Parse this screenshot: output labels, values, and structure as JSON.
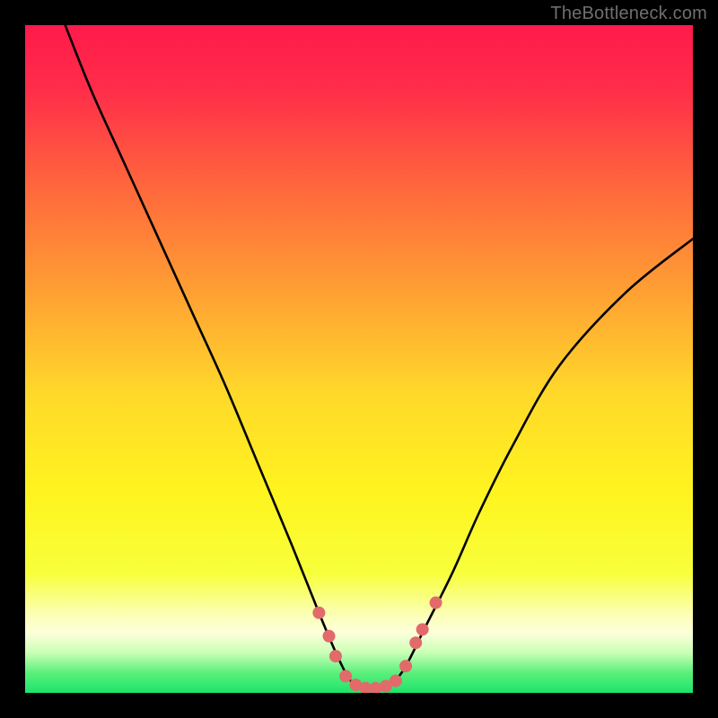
{
  "watermark": "TheBottleneck.com",
  "chart_data": {
    "type": "line",
    "title": "",
    "xlabel": "",
    "ylabel": "",
    "xlim": [
      0,
      100
    ],
    "ylim": [
      0,
      100
    ],
    "background_gradient": {
      "stops": [
        {
          "offset": 0.0,
          "color": "#ff1a4b"
        },
        {
          "offset": 0.1,
          "color": "#ff2e49"
        },
        {
          "offset": 0.25,
          "color": "#ff6a3c"
        },
        {
          "offset": 0.4,
          "color": "#ffa033"
        },
        {
          "offset": 0.55,
          "color": "#ffd82a"
        },
        {
          "offset": 0.7,
          "color": "#fff41f"
        },
        {
          "offset": 0.82,
          "color": "#f7ff3a"
        },
        {
          "offset": 0.88,
          "color": "#fbffb0"
        },
        {
          "offset": 0.91,
          "color": "#fdffdc"
        },
        {
          "offset": 0.94,
          "color": "#c9ffb5"
        },
        {
          "offset": 0.97,
          "color": "#5af07c"
        },
        {
          "offset": 1.0,
          "color": "#1de46a"
        }
      ]
    },
    "series": [
      {
        "name": "bottleneck-curve",
        "stroke": "#000000",
        "stroke_width": 2.6,
        "x": [
          6,
          10,
          15,
          20,
          25,
          30,
          35,
          40,
          44,
          47,
          49,
          51,
          53,
          55,
          57,
          60,
          64,
          68,
          73,
          80,
          90,
          100
        ],
        "y_pct": [
          100,
          90,
          79,
          68,
          57,
          46,
          34,
          22,
          12,
          5,
          1.5,
          0.7,
          0.7,
          1.5,
          4,
          10,
          18,
          27,
          37,
          49,
          60,
          68
        ]
      }
    ],
    "markers": {
      "color": "#e26a6a",
      "r": 7,
      "points": [
        {
          "x": 44.0,
          "y_pct": 12.0
        },
        {
          "x": 45.5,
          "y_pct": 8.5
        },
        {
          "x": 46.5,
          "y_pct": 5.5
        },
        {
          "x": 48.0,
          "y_pct": 2.5
        },
        {
          "x": 49.5,
          "y_pct": 1.2
        },
        {
          "x": 51.0,
          "y_pct": 0.7
        },
        {
          "x": 52.5,
          "y_pct": 0.7
        },
        {
          "x": 54.0,
          "y_pct": 1.0
        },
        {
          "x": 55.5,
          "y_pct": 1.8
        },
        {
          "x": 57.0,
          "y_pct": 4.0
        },
        {
          "x": 58.5,
          "y_pct": 7.5
        },
        {
          "x": 59.5,
          "y_pct": 9.5
        },
        {
          "x": 61.5,
          "y_pct": 13.5
        }
      ]
    }
  }
}
